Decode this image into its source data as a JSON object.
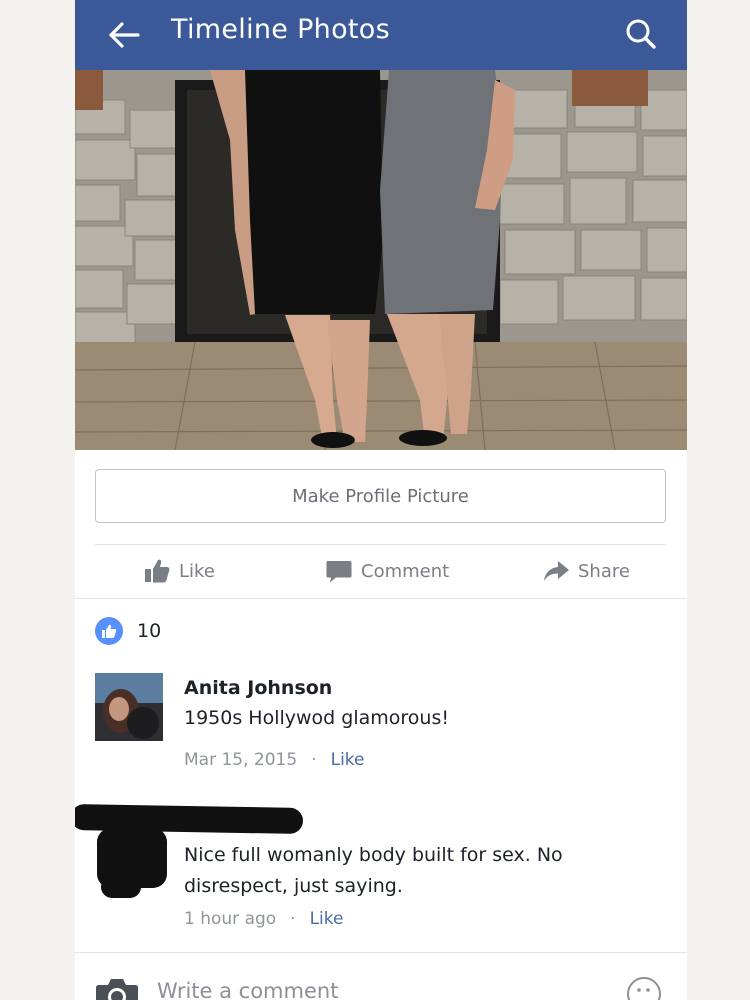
{
  "header": {
    "title": "Timeline Photos",
    "back_icon": "arrow-left-icon",
    "search_icon": "search-icon",
    "background": "#3b5998"
  },
  "photo": {
    "description_icon": "photo-two-women-by-fireplace"
  },
  "profile_button": {
    "label": "Make Profile Picture"
  },
  "actions": {
    "like": {
      "label": "Like",
      "icon": "thumbs-up-icon"
    },
    "comment": {
      "label": "Comment",
      "icon": "speech-bubble-icon"
    },
    "share": {
      "label": "Share",
      "icon": "share-arrow-icon"
    }
  },
  "reactions": {
    "count": "10",
    "icon": "like-badge-icon",
    "badge_color": "#5890ff"
  },
  "comments": [
    {
      "author": "Anita Johnson",
      "text": "1950s Hollywod glamorous!",
      "time": "Mar 15, 2015",
      "like_label": "Like"
    },
    {
      "author": "",
      "text": "Nice full womanly body built for sex. No disrespect, just saying.",
      "time": "1 hour ago",
      "like_label": "Like"
    }
  ],
  "composer": {
    "placeholder": "Write a comment",
    "camera_icon": "camera-icon",
    "emoji_icon": "smiley-icon"
  },
  "colors": {
    "link": "#4b6aa5",
    "meta": "#90949c",
    "muted_text": "#7a7e85"
  }
}
